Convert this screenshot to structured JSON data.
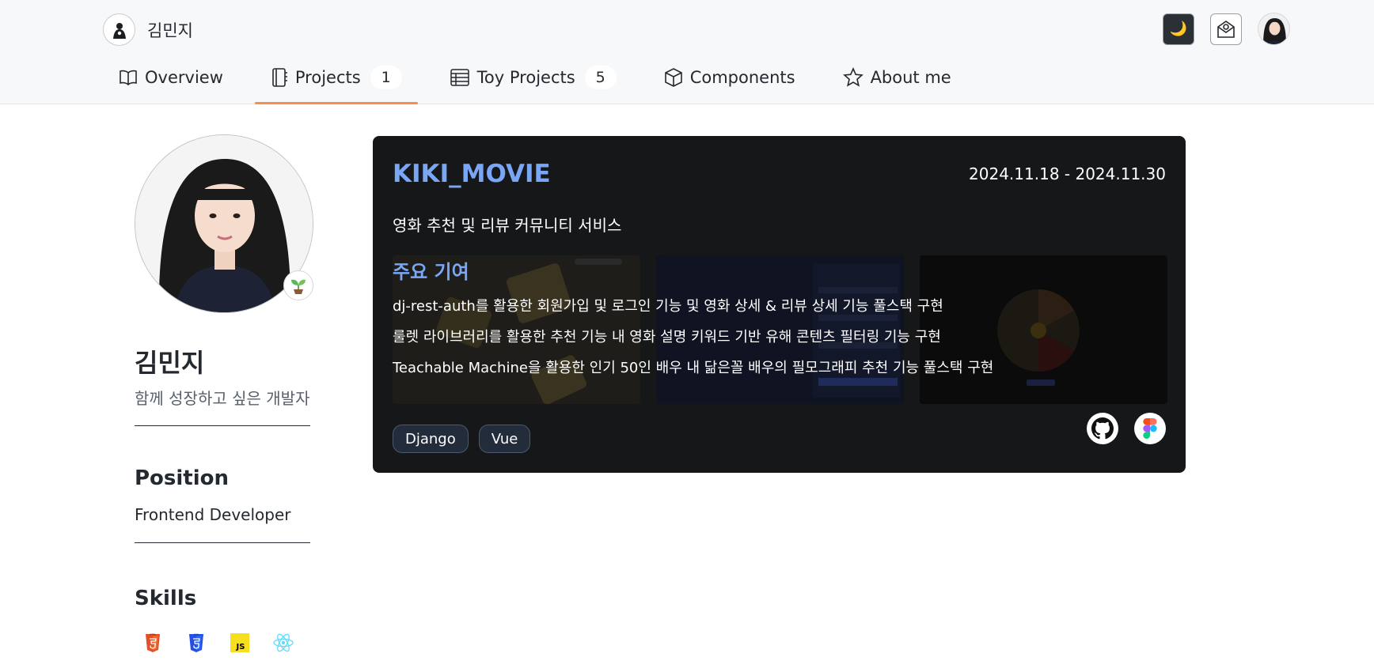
{
  "header": {
    "brand_name": "김민지",
    "theme_icon": "moon-icon",
    "mail_icon": "mail-icon"
  },
  "tabs": [
    {
      "label": "Overview",
      "icon": "book-icon"
    },
    {
      "label": "Projects",
      "count": "1",
      "icon": "notebook-icon",
      "active": true
    },
    {
      "label": "Toy Projects",
      "count": "5",
      "icon": "table-icon"
    },
    {
      "label": "Components",
      "icon": "cube-icon"
    },
    {
      "label": "About me",
      "icon": "star-icon"
    }
  ],
  "profile": {
    "name": "김민지",
    "bio": "함께 성장하고 싶은 개발자",
    "status_icon": "seedling-icon",
    "position_title": "Position",
    "position_value": "Frontend Developer",
    "skills_title": "Skills",
    "skills": [
      {
        "name": "html5-icon",
        "label": "HTML",
        "color": "#e34f26"
      },
      {
        "name": "css3-icon",
        "label": "CSS",
        "color": "#264de4"
      },
      {
        "name": "javascript-icon",
        "label": "JS",
        "color": "#f7df1e"
      },
      {
        "name": "react-icon",
        "color": "#61dafb"
      }
    ]
  },
  "project": {
    "title": "KIKI_MOVIE",
    "date": "2024.11.18 - 2024.11.30",
    "description": "영화 추천 및 리뷰 커뮤니티 서비스",
    "contrib_title": "주요 기여",
    "contributions": [
      "dj-rest-auth를 활용한 회원가입 및 로그인 기능 및 영화 상세 & 리뷰 상세 기능 풀스택 구현",
      "룰렛 라이브러리를 활용한 추천 기능 내 영화 설명 키워드 기반 유해 콘텐츠 필터링 기능 구현",
      "Teachable Machine을 활용한 인기 50인 배우 내 닮은꼴 배우의 필모그래피 추천 기능 풀스택 구현"
    ],
    "tags": [
      "Django",
      "Vue"
    ],
    "links": [
      "github-icon",
      "figma-icon"
    ]
  },
  "colors": {
    "accent": "#fd8c47",
    "title_blue": "#7aa7f5",
    "card_bg": "#161719"
  }
}
